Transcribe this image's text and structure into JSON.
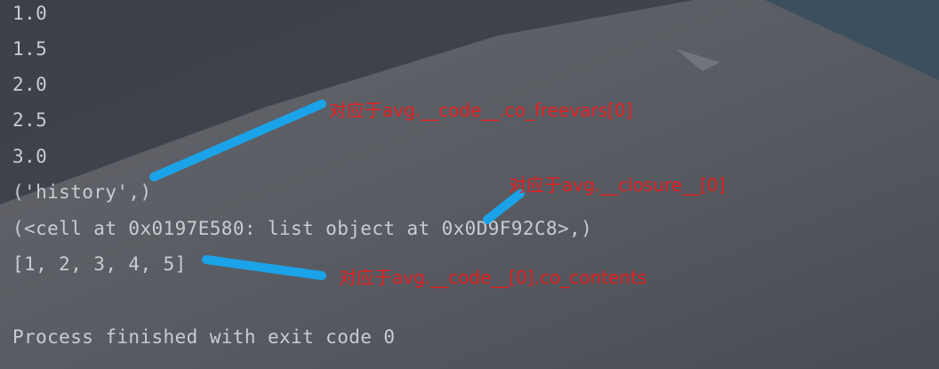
{
  "console": {
    "lines": [
      "1.0",
      "1.5",
      "2.0",
      "2.5",
      "3.0",
      "('history',)",
      "(<cell at 0x0197E580: list object at 0x0D9F92C8>,)",
      "[1, 2, 3, 4, 5]",
      "",
      "Process finished with exit code 0"
    ]
  },
  "annotations": {
    "freevars": "对应于avg.__code__.co_freevars[0]",
    "closure": "对应于avg.__closure__[0]",
    "contents": "对应于avg.__code__[0].co_contents"
  },
  "colors": {
    "annotation_text": "#e02020",
    "arrow": "#1aa3e8",
    "console_text": "#c9ccd1"
  }
}
